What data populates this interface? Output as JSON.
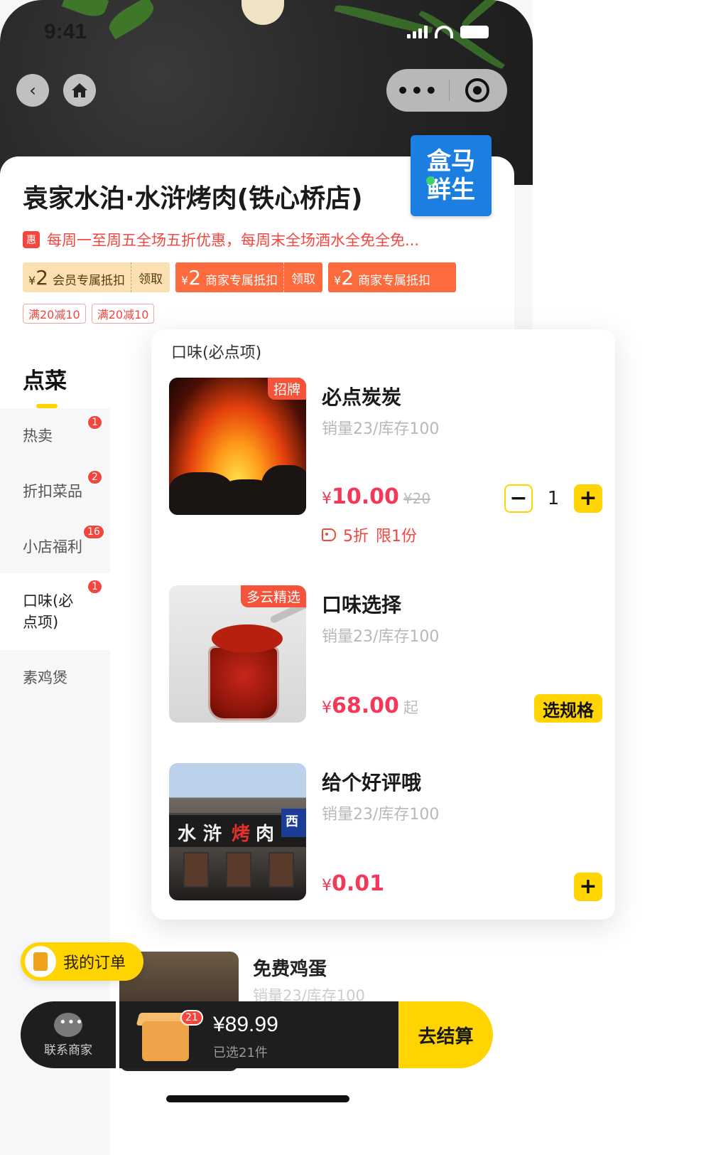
{
  "status_bar": {
    "time": "9:41"
  },
  "nav": {
    "back_icon": "chevron-left-icon",
    "home_icon": "home-icon",
    "more_label": "•••",
    "target_icon": "target-icon"
  },
  "shop": {
    "name": "袁家水泊·水浒烤肉(铁心桥店)",
    "logo_text": [
      "盒马",
      "鲜生"
    ],
    "promo_badge": "惠",
    "promo_text": "每周一至周五全场五折优惠，每周末全场酒水全免全免...",
    "coupons": [
      {
        "currency": "¥",
        "amount": "2",
        "label": "会员专属抵扣",
        "action": "领取",
        "style": "member"
      },
      {
        "currency": "¥",
        "amount": "2",
        "label": "商家专属抵扣",
        "action": "领取",
        "style": "merchant"
      },
      {
        "currency": "¥",
        "amount": "2",
        "label": "商家专属抵扣",
        "action": "",
        "style": "merchant"
      }
    ],
    "discount_tags": [
      "满20减10",
      "满20减10"
    ]
  },
  "sidebar": {
    "title": "点菜",
    "items": [
      {
        "label": "热卖",
        "badge": "1"
      },
      {
        "label": "折扣菜品",
        "badge": "2"
      },
      {
        "label": "小店福利",
        "badge": "16"
      },
      {
        "label": "口味(必点项)",
        "badge": "1"
      },
      {
        "label": "素鸡煲",
        "badge": ""
      }
    ]
  },
  "category_card": {
    "title": "口味(必点项)",
    "items": [
      {
        "tag": "招牌",
        "name": "必点炭炭",
        "sales": "销量23/库存100",
        "currency": "¥",
        "price": "10.00",
        "original_price": "¥20",
        "discount": "5折",
        "limit": "限1份",
        "quantity": "1"
      },
      {
        "tag": "多云精选",
        "name": "口味选择",
        "sales": "销量23/库存100",
        "currency": "¥",
        "price": "68.00",
        "suffix": "起",
        "action": "选规格"
      },
      {
        "name": "给个好评哦",
        "sales": "销量23/库存100",
        "currency": "¥",
        "price": "0.01",
        "store_sign": [
          "水",
          "浒",
          "烤",
          "肉"
        ],
        "store_sign_extra": "西"
      }
    ]
  },
  "next_item": {
    "name": "免费鸡蛋",
    "sales": "销量23/库存100"
  },
  "my_orders": {
    "label": "我的订单"
  },
  "bottom_bar": {
    "contact_label": "联系商家",
    "cart_count": "21",
    "total": "¥89.99",
    "selected": "已选21件",
    "checkout": "去结算"
  },
  "colors": {
    "accent": "#ffd400",
    "price": "#f3385a",
    "promo": "#f3463f",
    "logo_blue": "#1a7fe0"
  }
}
